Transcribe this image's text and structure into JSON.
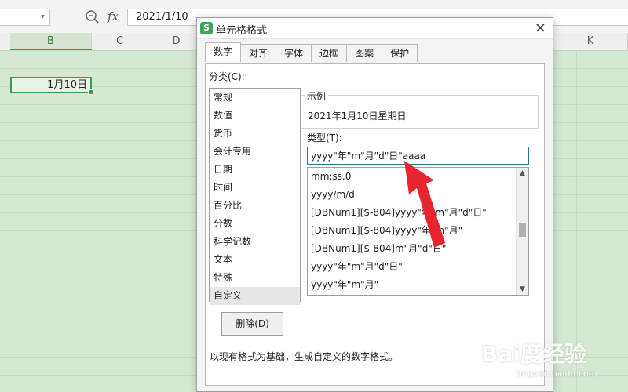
{
  "formula_bar": {
    "value": "2021/1/10",
    "fx_label": "fx"
  },
  "columns": [
    {
      "label": "B",
      "active": true
    },
    {
      "label": "C",
      "active": false
    },
    {
      "label": "D",
      "active": false
    },
    {
      "label": "K",
      "active": false
    }
  ],
  "selected_cell": {
    "value": "1月10日"
  },
  "dialog": {
    "title": "单元格格式",
    "app_icon": "S",
    "close_glyph": "×",
    "tabs": [
      "数字",
      "对齐",
      "字体",
      "边框",
      "图案",
      "保护"
    ],
    "active_tab": "数字",
    "category_label": "分类(C):",
    "categories": [
      "常规",
      "数值",
      "货币",
      "会计专用",
      "日期",
      "时间",
      "百分比",
      "分数",
      "科学记数",
      "文本",
      "特殊",
      "自定义"
    ],
    "selected_category": "自定义",
    "sample_label": "示例",
    "sample_value": "2021年1月10日星期日",
    "type_label": "类型(T):",
    "type_value": "yyyy\"年\"m\"月\"d\"日\"aaaa",
    "formats": [
      "mm:ss.0",
      "yyyy/m/d",
      "[DBNum1][$-804]yyyy\"年\"m\"月\"d\"日\"",
      "[DBNum1][$-804]yyyy\"年\"m\"月\"",
      "[DBNum1][$-804]m\"月\"d\"日\"",
      "yyyy\"年\"m\"月\"d\"日\"",
      "yyyy\"年\"m\"月\""
    ],
    "delete_button": "删除(D)",
    "hint": "以现有格式为基础，生成自定义的数字格式。"
  },
  "watermark": {
    "main": "Bai度经验",
    "sub": "jingyan.baidu.com"
  },
  "colors": {
    "accent_green": "#3c9a4a",
    "grid_green": "#d5e8d4",
    "arrow_red": "#e8242f"
  }
}
